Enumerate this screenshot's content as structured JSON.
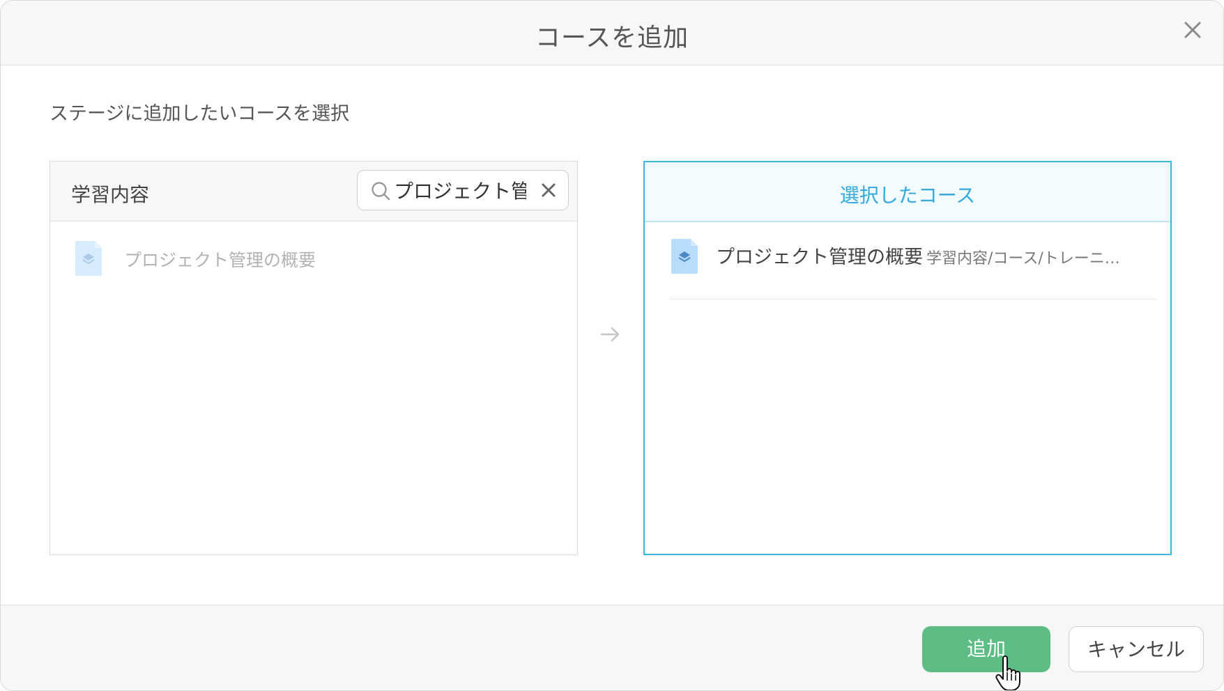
{
  "dialog": {
    "title": "コースを追加",
    "close_icon": "close-icon"
  },
  "instruction": "ステージに追加したいコースを選択",
  "left_panel": {
    "header": "学習内容",
    "search": {
      "value": "プロジェクト管",
      "placeholder": "",
      "icon": "search-icon",
      "clear_icon": "clear-icon"
    },
    "items": [
      {
        "name": "プロジェクト管理の概要",
        "icon": "course-doc-icon",
        "state": "disabled"
      }
    ]
  },
  "right_panel": {
    "header": "選択したコース",
    "items": [
      {
        "name": "プロジェクト管理の概要",
        "path": "学習内容/コース/トレーニ…",
        "icon": "course-doc-icon"
      }
    ]
  },
  "transfer_icon": "arrow-right-icon",
  "footer": {
    "add_label": "追加",
    "cancel_label": "キャンセル"
  },
  "colors": {
    "accent": "#3fb2e6",
    "primary_button": "#5dbd85",
    "doc_icon": "#b8dcfb"
  }
}
